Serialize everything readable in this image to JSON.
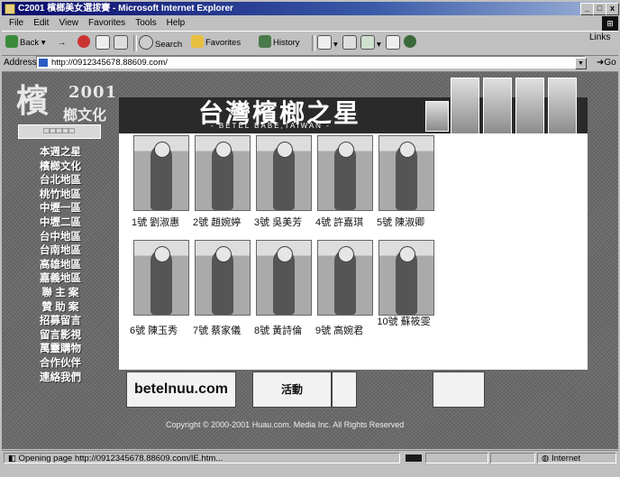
{
  "window": {
    "title": "C2001 檳榔美女選拔賽 - Microsoft Internet Explorer",
    "btn_min": "_",
    "btn_max": "□",
    "btn_close": "x"
  },
  "menu": [
    "File",
    "Edit",
    "View",
    "Favorites",
    "Tools",
    "Help"
  ],
  "toolbar": {
    "back": "Back",
    "forward": "→",
    "search": "Search",
    "favorites": "Favorites",
    "history": "History",
    "links": "Links"
  },
  "address": {
    "label": "Address",
    "url": "http://0912345678.88609.com/",
    "go": "Go"
  },
  "site": {
    "logo_char": "檳",
    "logo_year": "2001",
    "logo_sub": "榔文化",
    "nav_top": "□□□□□",
    "nav": [
      "本週之星",
      "檳榔文化",
      "台北地區",
      "桃竹地區",
      "中壢一區",
      "中壢二區",
      "台中地區",
      "台南地區",
      "高雄地區",
      "嘉義地區",
      "聯 主 案",
      "贊 助 案",
      "招募留言",
      "留言影視",
      "萬靈購物",
      "合作伙伴",
      "連絡我們"
    ],
    "banner_title": "台灣檳榔之星",
    "banner_en": "- BETEL BABE,TAIWAN -",
    "contestants_row1": [
      "1號 劉淑惠",
      "2號 趙婉婷",
      "3號 吳美芳",
      "4號 許嘉琪",
      "5號 陳淑卿"
    ],
    "contestants_row2": [
      "6號 陳玉秀",
      "7號 蔡家儀",
      "8號 黃詩倫",
      "9號 高婉君",
      "10號 蘇筱雯"
    ],
    "sponsor1": "betelnuu.com",
    "sponsor2": "活動",
    "copyright": "Copyright © 2000-2001 Huau.com. Media Inc. All Rights Reserved"
  },
  "status": {
    "text": "Opening page http://0912345678.88609.com/IE.htm...",
    "zone": "Internet"
  }
}
